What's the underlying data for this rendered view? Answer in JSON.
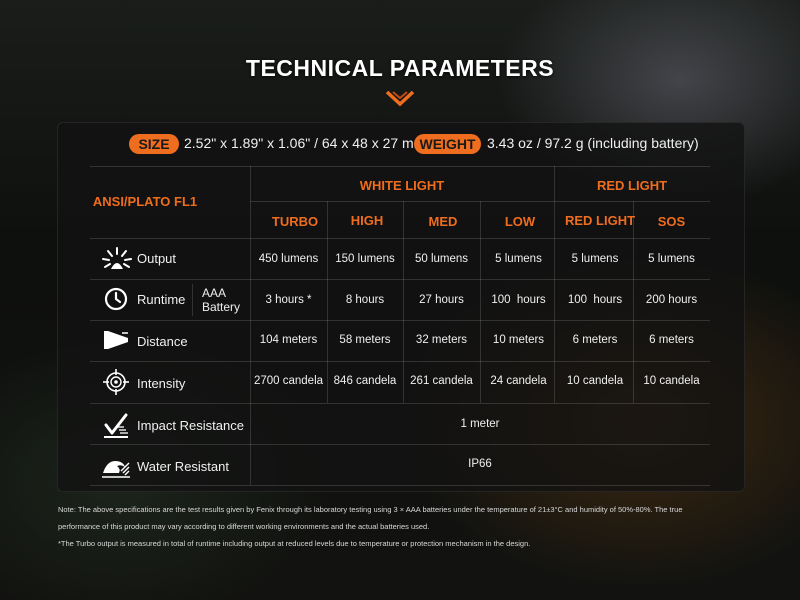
{
  "title": "TECHNICAL PARAMETERS",
  "accent_color": "#ef6d1e",
  "size": {
    "label": "SIZE",
    "value": "2.52\" x 1.89\" x 1.06\" / 64 x 48 x 27 mm"
  },
  "weight": {
    "label": "WEIGHT",
    "value": "3.43 oz / 97.2 g (including battery)"
  },
  "table": {
    "standard": "ANSI/PLATO FL1",
    "groups": {
      "white": "WHITE LIGHT",
      "red": "RED LIGHT"
    },
    "modes": [
      "TURBO",
      "HIGH",
      "MED",
      "LOW",
      "RED LIGHT",
      "SOS"
    ],
    "rows": {
      "output": {
        "label": "Output",
        "icon": "sunburst-icon",
        "values": [
          "450 lumens",
          "150 lumens",
          "50 lumens",
          "5 lumens",
          "5 lumens",
          "5 lumens"
        ]
      },
      "runtime": {
        "label": "Runtime",
        "sublabel_line1": "AAA",
        "sublabel_line2": "Battery",
        "icon": "clock-icon",
        "values": [
          "3 hours *",
          "8 hours",
          "27 hours",
          "100  hours",
          "100  hours",
          "200 hours"
        ]
      },
      "distance": {
        "label": "Distance",
        "icon": "beam-icon",
        "values": [
          "104 meters",
          "58 meters",
          "32 meters",
          "10 meters",
          "6 meters",
          "6 meters"
        ]
      },
      "intensity": {
        "label": "Intensity",
        "icon": "crosshair-icon",
        "values": [
          "2700 candela",
          "846 candela",
          "261 candela",
          "24 candela",
          "10 candela",
          "10 candela"
        ]
      },
      "impact": {
        "label": "Impact Resistance",
        "icon": "impact-icon",
        "value": "1 meter"
      },
      "water": {
        "label": "Water Resistant",
        "icon": "wave-icon",
        "value": "IP66"
      }
    }
  },
  "notes": {
    "line1": "Note: The above specifications are the test results given by Fenix through its laboratory testing using 3 × AAA batteries under the temperature of 21±3°C and humidity of 50%-80%. The true",
    "line2": "performance of this product may vary according to different working environments and the actual batteries used.",
    "line3": "*The Turbo output is measured in total of runtime including output at reduced levels due to temperature or protection mechanism in the design."
  }
}
